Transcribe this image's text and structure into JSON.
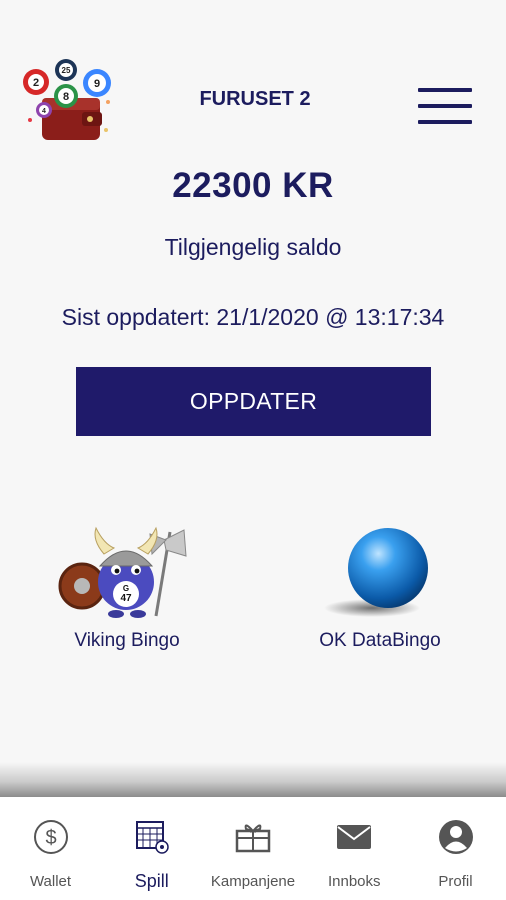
{
  "header": {
    "site_name": "FURUSET 2",
    "logo_numbers": [
      "2",
      "25",
      "9",
      "8",
      "4"
    ]
  },
  "wallet": {
    "balance": "22300 KR",
    "balance_label": "Tilgjengelig saldo",
    "last_updated": "Sist oppdatert: 21/1/2020 @ 13:17:34",
    "update_button": "OPPDATER"
  },
  "games": [
    {
      "label": "Viking Bingo",
      "ball_letter": "G",
      "ball_number": "47",
      "icon": "viking-bingo-icon"
    },
    {
      "label": "OK DataBingo",
      "icon": "blue-ball-icon"
    }
  ],
  "nav": {
    "items": [
      {
        "label": "Wallet",
        "icon": "dollar-circle-icon"
      },
      {
        "label": "Spill",
        "icon": "bingo-card-icon",
        "active": true
      },
      {
        "label": "Kampanjene",
        "icon": "gift-icon"
      },
      {
        "label": "Innboks",
        "icon": "mail-icon"
      },
      {
        "label": "Profil",
        "icon": "profile-icon"
      }
    ]
  },
  "colors": {
    "primary": "#1f1a6a",
    "text": "#1c1c5e",
    "background": "#f7f7f7",
    "nav_icon": "#555555"
  }
}
